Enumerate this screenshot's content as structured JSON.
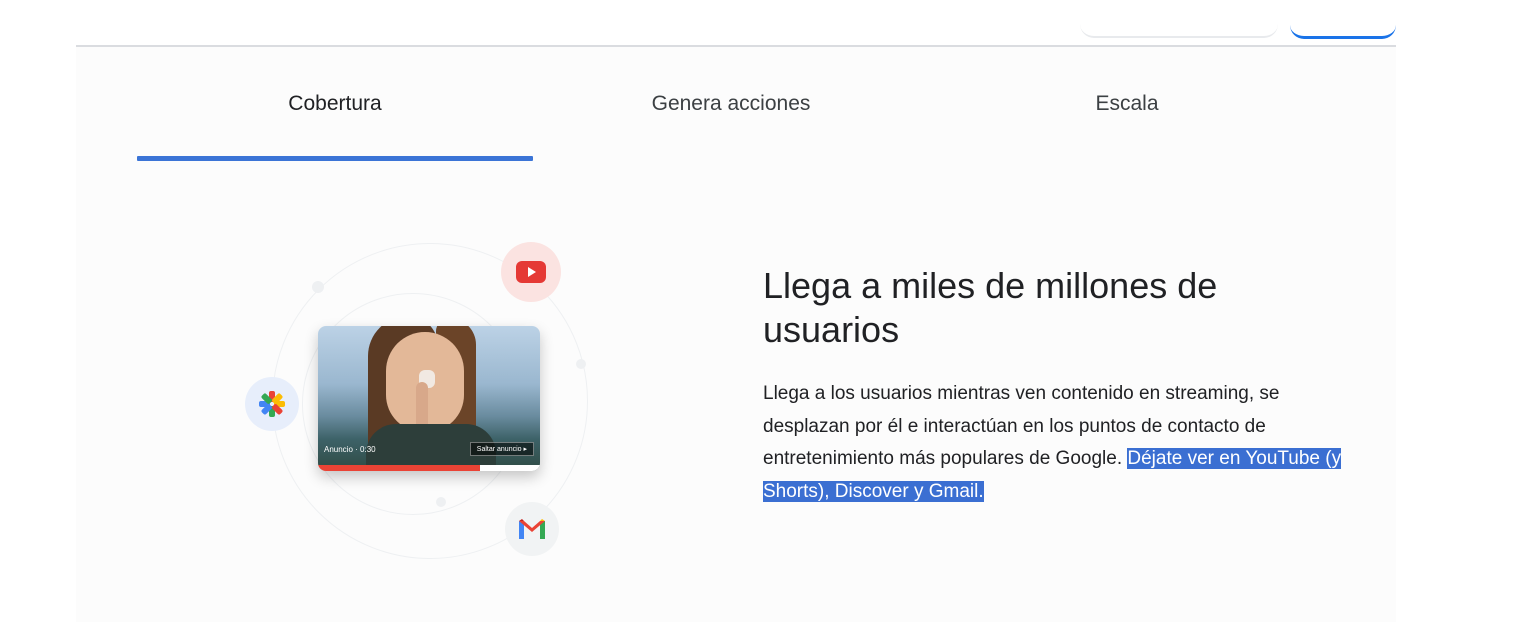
{
  "tabs": [
    {
      "label": "Cobertura",
      "selected": true
    },
    {
      "label": "Genera acciones",
      "selected": false
    },
    {
      "label": "Escala",
      "selected": false
    }
  ],
  "hero": {
    "title": "Llega a miles de millones de usuarios",
    "body_plain": "Llega a los usuarios mientras ven contenido en streaming, se desplazan por él e interactúan en los puntos de contacto de entretenimiento más populares de Google. ",
    "body_highlighted": "Déjate ver en YouTube (y Shorts), Discover y Gmail."
  },
  "video_card": {
    "ad_label": "Anuncio · 0:30",
    "skip_label": "Saltar anuncio ▸",
    "progress": 0.73
  },
  "icons": {
    "youtube": "youtube-icon",
    "discover": "discover-icon",
    "gmail": "gmail-icon"
  },
  "colors": {
    "accent": "#3b74d6",
    "highlight": "#3b6fd2",
    "youtube_red": "#ea4335"
  }
}
